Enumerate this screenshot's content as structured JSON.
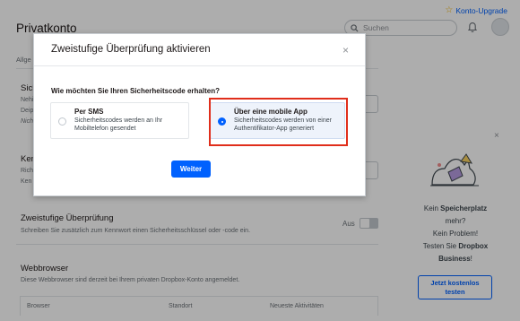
{
  "header": {
    "upgrade_label": "Konto-Upgrade",
    "page_title": "Privatkonto",
    "search_placeholder": "Suchen",
    "nav_fragment": "Allge"
  },
  "sections": {
    "s1_title_fragment": "Sich",
    "s1_desc_fragments": [
      "Nehi",
      "Deip",
      "Nich"
    ],
    "s1_button_fragment": "n",
    "s2_title_fragment": "Ken",
    "s2_desc_fragments": [
      "Rich",
      "Ken"
    ],
    "s2_button_fragment": "n",
    "two_step": {
      "title": "Zweistufige Überprüfung",
      "description": "Schreiben Sie zusätzlich zum Kennwort einen Sicherheitsschlüssel oder -code ein.",
      "toggle_label": "Aus"
    },
    "browser": {
      "title": "Webbrowser",
      "description": "Diese Webbrowser sind derzeit bei Ihrem privaten Dropbox-Konto angemeldet.",
      "columns": [
        "Browser",
        "Standort",
        "Neueste Aktivitäten"
      ]
    }
  },
  "promo": {
    "line1_prefix": "Kein ",
    "line1_bold": "Speicherplatz",
    "line2": "mehr?",
    "line3": "Kein Problem!",
    "line4_prefix": "Testen Sie ",
    "line4_bold": "Dropbox",
    "line5_bold": "Business",
    "line5_suffix": "!",
    "button_line1": "Jetzt kostenlos",
    "button_line2": "testen"
  },
  "modal": {
    "title": "Zweistufige Überprüfung aktivieren",
    "close_glyph": "×",
    "question": "Wie möchten Sie Ihren Sicherheitscode erhalten?",
    "options": [
      {
        "title": "Per SMS",
        "description": "Sicherheitscodes werden an Ihr Mobiltelefon gesendet",
        "selected": false
      },
      {
        "title": "Über eine mobile App",
        "description": "Sicherheitscodes werden von einer Authentifikator-App generiert",
        "selected": true
      }
    ],
    "primary_button": "Weiter"
  },
  "colors": {
    "accent": "#0061fe",
    "highlight_border": "#e02e1b",
    "selected_option_bg": "#eef3fb"
  },
  "icons": {
    "upgrade": "star-icon",
    "search": "search-icon",
    "notifications": "bell-icon",
    "close": "close-icon"
  }
}
